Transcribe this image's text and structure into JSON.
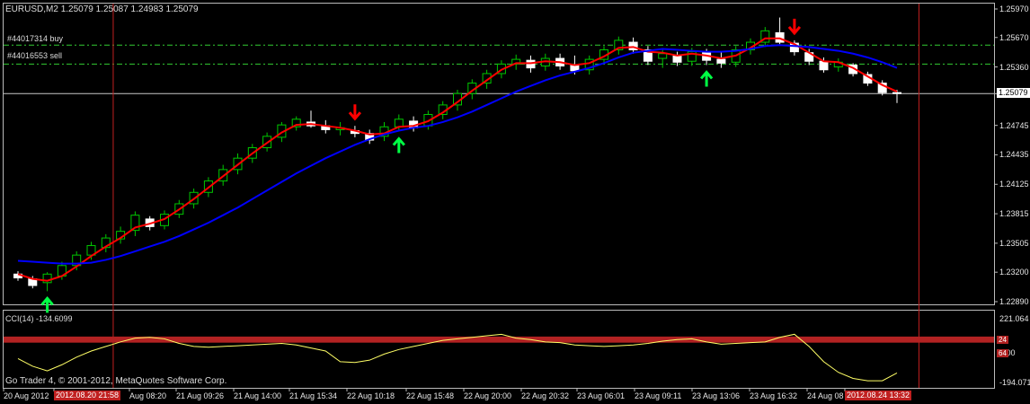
{
  "chart_header": {
    "symbol_text": "EURUSD,M2",
    "ohlc_text": "1.25079 1.25087 1.24983 1.25079"
  },
  "order_lines": [
    {
      "label": "#44017314 buy",
      "price": 1.2559
    },
    {
      "label": "#44016553 sell",
      "price": 1.2539
    }
  ],
  "copyright": "Go Trader 4, © 2001-2012, MetaQuotes Software Corp.",
  "colors": {
    "background": "#000000",
    "bull_candle": "#00c800",
    "bear_candle": "#ffffff",
    "fast_ma": "#ff0000",
    "slow_ma": "#0000ff",
    "cci_line": "#ffff66",
    "cci_band": "#b22222",
    "vline": "#c02020",
    "buy_arrow": "#00ff44",
    "sell_arrow": "#ff0000",
    "grid_order": "#33cc33"
  },
  "chart_data": [
    {
      "type": "candlestick",
      "title": "EURUSD,M2",
      "ylim": [
        1.2289,
        1.2597
      ],
      "y_ticks": [
        "1.25970",
        "1.25670",
        "1.25360",
        "1.25079",
        "1.24745",
        "1.24435",
        "1.24125",
        "1.23815",
        "1.23505",
        "1.23200",
        "1.22890"
      ],
      "current_price": "1.25079",
      "current_price_value": 1.25079,
      "x_ticks": [
        "20 Aug 2012",
        "2012.08.20 21:58",
        "Aug 08:20",
        "21 Aug 09:26",
        "21 Aug 14:00",
        "21 Aug 15:34",
        "22 Aug 10:18",
        "22 Aug 15:48",
        "22 Aug 20:00",
        "22 Aug 20:32",
        "23 Aug 06:01",
        "23 Aug 09:11",
        "23 Aug 13:06",
        "23 Aug 16:32",
        "24 Aug 08",
        "2012.08.24 13:32"
      ],
      "highlighted_x_ticks": [
        1,
        15
      ],
      "vertical_lines_at_bar": [
        6,
        61
      ],
      "candles": [
        {
          "o": 1.2318,
          "h": 1.2321,
          "l": 1.2311,
          "c": 1.2314
        },
        {
          "o": 1.2313,
          "h": 1.2316,
          "l": 1.2303,
          "c": 1.2306
        },
        {
          "o": 1.2309,
          "h": 1.232,
          "l": 1.23,
          "c": 1.2318
        },
        {
          "o": 1.2316,
          "h": 1.2331,
          "l": 1.2312,
          "c": 1.2327
        },
        {
          "o": 1.2327,
          "h": 1.2342,
          "l": 1.2322,
          "c": 1.2338
        },
        {
          "o": 1.2338,
          "h": 1.2352,
          "l": 1.2333,
          "c": 1.2348
        },
        {
          "o": 1.2346,
          "h": 1.236,
          "l": 1.2341,
          "c": 1.2356
        },
        {
          "o": 1.2355,
          "h": 1.2368,
          "l": 1.235,
          "c": 1.2363
        },
        {
          "o": 1.2364,
          "h": 1.2384,
          "l": 1.2358,
          "c": 1.238
        },
        {
          "o": 1.2376,
          "h": 1.2379,
          "l": 1.2364,
          "c": 1.2368
        },
        {
          "o": 1.2369,
          "h": 1.2385,
          "l": 1.2365,
          "c": 1.2381
        },
        {
          "o": 1.2381,
          "h": 1.2396,
          "l": 1.2377,
          "c": 1.2392
        },
        {
          "o": 1.2392,
          "h": 1.2408,
          "l": 1.2387,
          "c": 1.2404
        },
        {
          "o": 1.2404,
          "h": 1.242,
          "l": 1.2399,
          "c": 1.2416
        },
        {
          "o": 1.2416,
          "h": 1.2433,
          "l": 1.2411,
          "c": 1.2428
        },
        {
          "o": 1.2428,
          "h": 1.2445,
          "l": 1.2423,
          "c": 1.244
        },
        {
          "o": 1.244,
          "h": 1.2455,
          "l": 1.2435,
          "c": 1.2451
        },
        {
          "o": 1.2451,
          "h": 1.2467,
          "l": 1.2447,
          "c": 1.2463
        },
        {
          "o": 1.2462,
          "h": 1.2478,
          "l": 1.2457,
          "c": 1.2475
        },
        {
          "o": 1.2473,
          "h": 1.2484,
          "l": 1.2469,
          "c": 1.2481
        },
        {
          "o": 1.2478,
          "h": 1.249,
          "l": 1.2472,
          "c": 1.2474
        },
        {
          "o": 1.2474,
          "h": 1.248,
          "l": 1.2466,
          "c": 1.247
        },
        {
          "o": 1.247,
          "h": 1.2478,
          "l": 1.2464,
          "c": 1.2472
        },
        {
          "o": 1.2469,
          "h": 1.2474,
          "l": 1.2462,
          "c": 1.2466
        },
        {
          "o": 1.2466,
          "h": 1.247,
          "l": 1.2455,
          "c": 1.2459
        },
        {
          "o": 1.2463,
          "h": 1.2478,
          "l": 1.2458,
          "c": 1.2473
        },
        {
          "o": 1.2473,
          "h": 1.2486,
          "l": 1.2468,
          "c": 1.2481
        },
        {
          "o": 1.2479,
          "h": 1.2484,
          "l": 1.2468,
          "c": 1.2472
        },
        {
          "o": 1.2474,
          "h": 1.249,
          "l": 1.247,
          "c": 1.2486
        },
        {
          "o": 1.2486,
          "h": 1.25,
          "l": 1.2481,
          "c": 1.2496
        },
        {
          "o": 1.2496,
          "h": 1.2512,
          "l": 1.249,
          "c": 1.2508
        },
        {
          "o": 1.2508,
          "h": 1.2523,
          "l": 1.2502,
          "c": 1.2519
        },
        {
          "o": 1.2519,
          "h": 1.2533,
          "l": 1.2513,
          "c": 1.2529
        },
        {
          "o": 1.2529,
          "h": 1.2543,
          "l": 1.2524,
          "c": 1.2539
        },
        {
          "o": 1.2539,
          "h": 1.2549,
          "l": 1.2533,
          "c": 1.2544
        },
        {
          "o": 1.2543,
          "h": 1.2548,
          "l": 1.253,
          "c": 1.2535
        },
        {
          "o": 1.2537,
          "h": 1.255,
          "l": 1.2532,
          "c": 1.2545
        },
        {
          "o": 1.2545,
          "h": 1.255,
          "l": 1.2533,
          "c": 1.2537
        },
        {
          "o": 1.2538,
          "h": 1.2548,
          "l": 1.2528,
          "c": 1.2532
        },
        {
          "o": 1.2533,
          "h": 1.2548,
          "l": 1.2528,
          "c": 1.2544
        },
        {
          "o": 1.2544,
          "h": 1.2558,
          "l": 1.2539,
          "c": 1.2554
        },
        {
          "o": 1.2554,
          "h": 1.2568,
          "l": 1.2549,
          "c": 1.2564
        },
        {
          "o": 1.2562,
          "h": 1.2567,
          "l": 1.255,
          "c": 1.2554
        },
        {
          "o": 1.2554,
          "h": 1.2558,
          "l": 1.2538,
          "c": 1.2542
        },
        {
          "o": 1.2545,
          "h": 1.2555,
          "l": 1.2535,
          "c": 1.255
        },
        {
          "o": 1.2548,
          "h": 1.2552,
          "l": 1.2537,
          "c": 1.2541
        },
        {
          "o": 1.2542,
          "h": 1.2556,
          "l": 1.2537,
          "c": 1.2552
        },
        {
          "o": 1.2551,
          "h": 1.2555,
          "l": 1.2538,
          "c": 1.2543
        },
        {
          "o": 1.2544,
          "h": 1.2552,
          "l": 1.2535,
          "c": 1.254
        },
        {
          "o": 1.2541,
          "h": 1.2558,
          "l": 1.2536,
          "c": 1.2554
        },
        {
          "o": 1.2554,
          "h": 1.2566,
          "l": 1.2549,
          "c": 1.2562
        },
        {
          "o": 1.2562,
          "h": 1.2578,
          "l": 1.2557,
          "c": 1.2574
        },
        {
          "o": 1.2572,
          "h": 1.2588,
          "l": 1.256,
          "c": 1.2562
        },
        {
          "o": 1.2561,
          "h": 1.2564,
          "l": 1.2548,
          "c": 1.2552
        },
        {
          "o": 1.2551,
          "h": 1.2555,
          "l": 1.2538,
          "c": 1.2542
        },
        {
          "o": 1.2542,
          "h": 1.2546,
          "l": 1.253,
          "c": 1.2533
        },
        {
          "o": 1.2536,
          "h": 1.2545,
          "l": 1.2531,
          "c": 1.2541
        },
        {
          "o": 1.2538,
          "h": 1.254,
          "l": 1.2526,
          "c": 1.2529
        },
        {
          "o": 1.2528,
          "h": 1.2531,
          "l": 1.2516,
          "c": 1.2519
        },
        {
          "o": 1.2519,
          "h": 1.2522,
          "l": 1.2506,
          "c": 1.2509
        },
        {
          "o": 1.2509,
          "h": 1.2512,
          "l": 1.2498,
          "c": 1.2508
        }
      ],
      "series": [
        {
          "values": [
            1.2318,
            1.2313,
            1.2311,
            1.2316,
            1.2326,
            1.2337,
            1.2347,
            1.2356,
            1.2367,
            1.2371,
            1.2376,
            1.2386,
            1.2397,
            1.2409,
            1.2421,
            1.2433,
            1.2445,
            1.2456,
            1.2467,
            1.2475,
            1.2476,
            1.2474,
            1.2472,
            1.2469,
            1.2465,
            1.2466,
            1.2473,
            1.2474,
            1.2479,
            1.2488,
            1.2499,
            1.2511,
            1.2522,
            1.2533,
            1.254,
            1.254,
            1.2542,
            1.2541,
            1.2538,
            1.254,
            1.2547,
            1.2556,
            1.2557,
            1.2552,
            1.2551,
            1.2548,
            1.255,
            1.2548,
            1.2545,
            1.2548,
            1.2556,
            1.2566,
            1.2566,
            1.256,
            1.2551,
            1.2542,
            1.2541,
            1.2535,
            1.2526,
            1.2517,
            1.251
          ]
        },
        {
          "values": [
            1.2332,
            1.2331,
            1.233,
            1.2329,
            1.2329,
            1.233,
            1.2333,
            1.2337,
            1.2342,
            1.2347,
            1.2352,
            1.2358,
            1.2365,
            1.2372,
            1.238,
            1.2388,
            1.2397,
            1.2406,
            1.2415,
            1.2424,
            1.2432,
            1.244,
            1.2447,
            1.2454,
            1.246,
            1.2465,
            1.2469,
            1.2472,
            1.2474,
            1.2478,
            1.2483,
            1.2489,
            1.2496,
            1.2503,
            1.251,
            1.2516,
            1.2522,
            1.2527,
            1.2531,
            1.2535,
            1.254,
            1.2546,
            1.2551,
            1.2553,
            1.2555,
            1.2554,
            1.2553,
            1.2552,
            1.2552,
            1.2553,
            1.2555,
            1.2558,
            1.2559,
            1.2558,
            1.2557,
            1.2555,
            1.2553,
            1.255,
            1.2546,
            1.2541,
            1.2535
          ]
        }
      ],
      "buy_arrows_at_bar": [
        2,
        26,
        47
      ],
      "sell_arrows_at_bar": [
        23,
        53
      ]
    },
    {
      "type": "line",
      "title": "CCI(14) -134.6099",
      "ylim": [
        -220,
        240
      ],
      "y_ticks": [
        "221.064",
        "0.00",
        "-194.071"
      ],
      "band": [
        65,
        105
      ],
      "band_labels": [
        "24",
        "64"
      ],
      "values": [
        -40,
        -90,
        -120,
        -80,
        -30,
        10,
        40,
        70,
        95,
        100,
        90,
        60,
        40,
        35,
        40,
        45,
        50,
        55,
        60,
        50,
        30,
        10,
        -60,
        -65,
        -50,
        -10,
        20,
        40,
        60,
        80,
        90,
        100,
        110,
        120,
        95,
        85,
        70,
        65,
        50,
        45,
        40,
        45,
        50,
        60,
        75,
        85,
        90,
        70,
        55,
        60,
        65,
        70,
        100,
        120,
        40,
        -60,
        -130,
        -170,
        -185,
        -185,
        -134
      ]
    }
  ]
}
